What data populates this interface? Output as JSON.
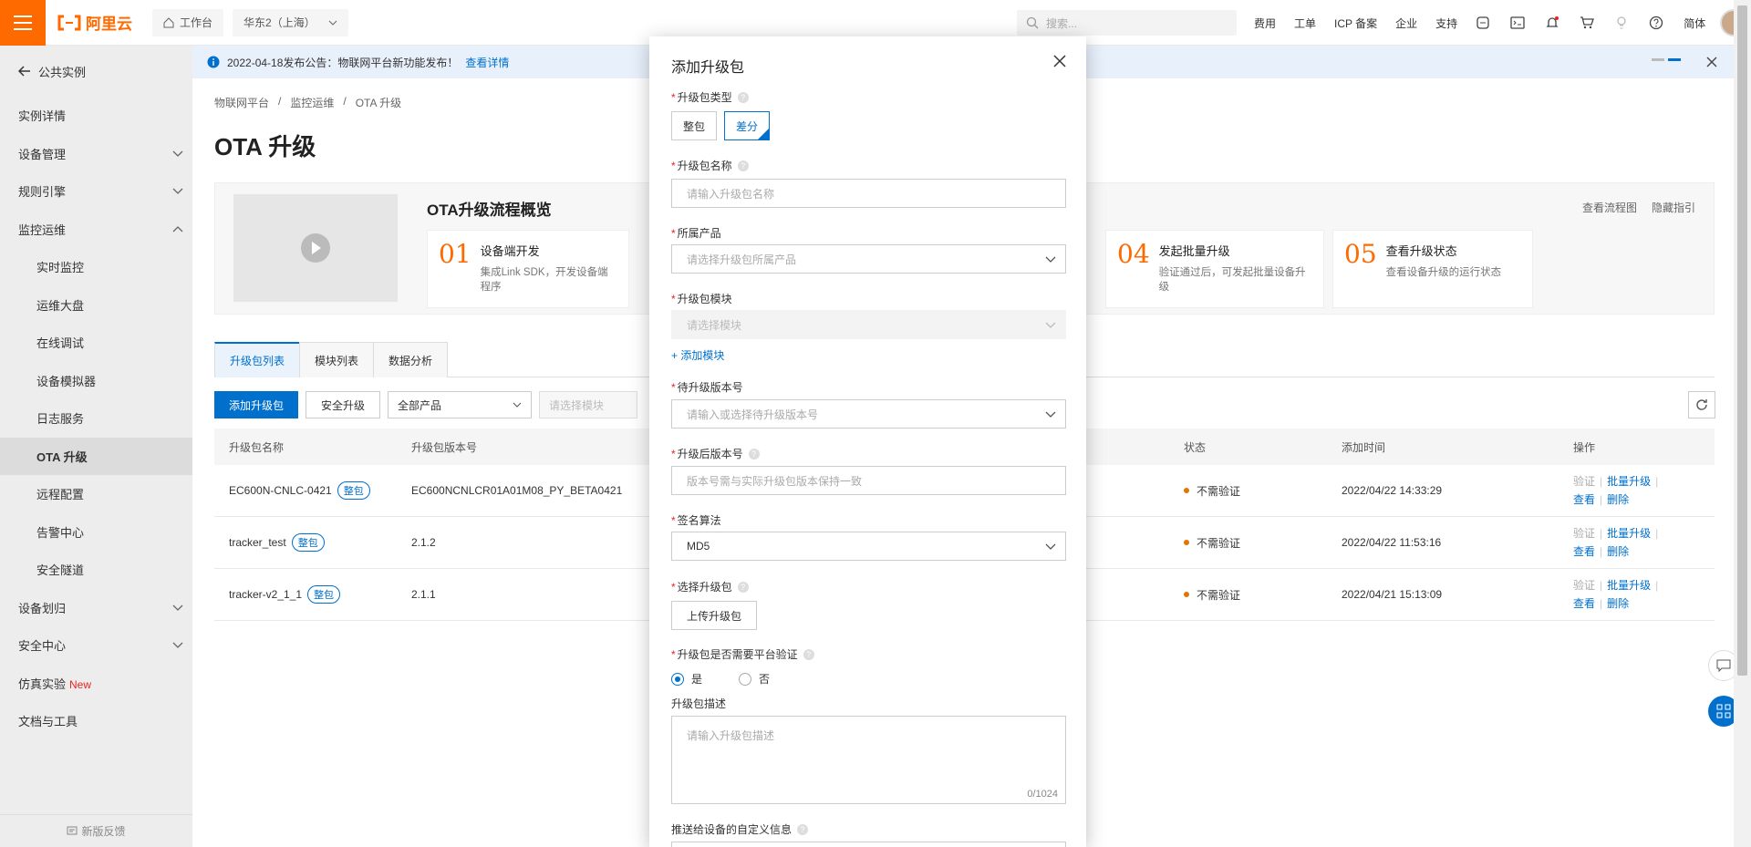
{
  "topbar": {
    "logo_text": "阿里云",
    "workbench": "工作台",
    "region": "华东2（上海）",
    "search_placeholder": "搜索...",
    "links": [
      "费用",
      "工单",
      "ICP 备案",
      "企业",
      "支持"
    ],
    "lang": "简体"
  },
  "notice": {
    "text": "2022-04-18发布公告：物联网平台新功能发布！",
    "link": "查看详情"
  },
  "sidebar": {
    "back": "公共实例",
    "items": [
      {
        "label": "实例详情",
        "sub": false,
        "expand": ""
      },
      {
        "label": "设备管理",
        "sub": false,
        "expand": "down"
      },
      {
        "label": "规则引擎",
        "sub": false,
        "expand": "down"
      },
      {
        "label": "监控运维",
        "sub": false,
        "expand": "up"
      },
      {
        "label": "实时监控",
        "sub": true,
        "expand": ""
      },
      {
        "label": "运维大盘",
        "sub": true,
        "expand": ""
      },
      {
        "label": "在线调试",
        "sub": true,
        "expand": ""
      },
      {
        "label": "设备模拟器",
        "sub": true,
        "expand": ""
      },
      {
        "label": "日志服务",
        "sub": true,
        "expand": ""
      },
      {
        "label": "OTA 升级",
        "sub": true,
        "expand": "",
        "active": true
      },
      {
        "label": "远程配置",
        "sub": true,
        "expand": ""
      },
      {
        "label": "告警中心",
        "sub": true,
        "expand": ""
      },
      {
        "label": "安全隧道",
        "sub": true,
        "expand": ""
      },
      {
        "label": "设备划归",
        "sub": false,
        "expand": "down"
      },
      {
        "label": "安全中心",
        "sub": false,
        "expand": "down"
      },
      {
        "label": "仿真实验",
        "sub": false,
        "expand": "",
        "badge": "New"
      },
      {
        "label": "文档与工具",
        "sub": false,
        "expand": ""
      }
    ],
    "feedback": "新版反馈"
  },
  "page": {
    "breadcrumb": [
      "物联网平台",
      "监控运维",
      "OTA 升级"
    ],
    "title": "OTA 升级",
    "guide_title": "OTA升级流程概览",
    "guide_links": [
      "查看流程图",
      "隐藏指引"
    ],
    "steps": [
      {
        "num": "01",
        "title": "设备端开发",
        "desc": "集成Link SDK，开发设备端程序"
      },
      {
        "num": "04",
        "title": "发起批量升级",
        "desc": "验证通过后，可发起批量设备升级"
      },
      {
        "num": "05",
        "title": "查看升级状态",
        "desc": "查看设备升级的运行状态"
      }
    ],
    "tabs": [
      "升级包列表",
      "模块列表",
      "数据分析"
    ],
    "toolbar": {
      "add": "添加升级包",
      "safe": "安全升级",
      "product": "全部产品",
      "module": "请选择模块"
    },
    "columns": [
      "升级包名称",
      "升级包版本号",
      "状态",
      "添加时间",
      "操作"
    ],
    "rows": [
      {
        "name": "EC600N-CNLC-0421",
        "tag": "整包",
        "version": "EC600NCNLCR01A01M08_PY_BETA0421",
        "status": "不需验证",
        "time": "2022/04/22 14:33:29"
      },
      {
        "name": "tracker_test",
        "tag": "整包",
        "version": "2.1.2",
        "status": "不需验证",
        "time": "2022/04/22 11:53:16"
      },
      {
        "name": "tracker-v2_1_1",
        "tag": "整包",
        "version": "2.1.1",
        "status": "不需验证",
        "time": "2022/04/21 15:13:09"
      }
    ],
    "ops": {
      "verify": "验证",
      "batch": "批量升级",
      "view": "查看",
      "delete": "删除"
    }
  },
  "modal": {
    "title": "添加升级包",
    "type_label": "升级包类型",
    "type_options": [
      "整包",
      "差分"
    ],
    "type_selected": "差分",
    "name_label": "升级包名称",
    "name_placeholder": "请输入升级包名称",
    "product_label": "所属产品",
    "product_placeholder": "请选择升级包所属产品",
    "module_label": "升级包模块",
    "module_placeholder": "请选择模块",
    "add_module": "+ 添加模块",
    "from_version_label": "待升级版本号",
    "from_version_placeholder": "请输入或选择待升级版本号",
    "to_version_label": "升级后版本号",
    "to_version_placeholder": "版本号需与实际升级包版本保持一致",
    "sign_label": "签名算法",
    "sign_value": "MD5",
    "upload_label": "选择升级包",
    "upload_button": "上传升级包",
    "verify_label": "升级包是否需要平台验证",
    "verify_yes": "是",
    "verify_no": "否",
    "desc_label": "升级包描述",
    "desc_placeholder": "请输入升级包描述",
    "desc_count": "0/1024",
    "custom_label": "推送给设备的自定义信息"
  },
  "colors": {
    "brand": "#ff6a00",
    "primary": "#0070cc"
  }
}
